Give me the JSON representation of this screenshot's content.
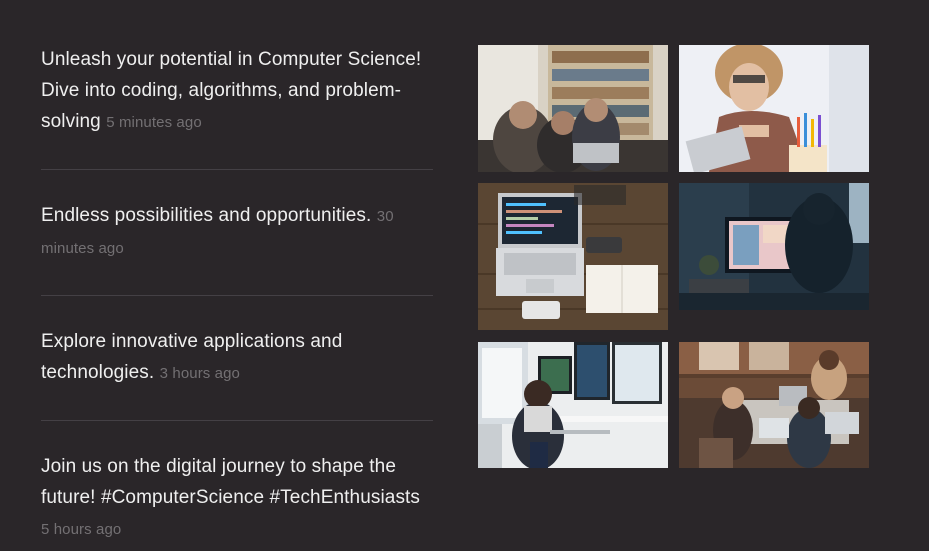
{
  "feed": {
    "posts": [
      {
        "text": "Unleash your potential in Computer Science! Dive into coding, algorithms, and problem-solving",
        "time": "5 minutes ago"
      },
      {
        "text": "Endless possibilities and opportunities.",
        "time": "30 minutes ago"
      },
      {
        "text": "Explore innovative applications and technologies.",
        "time": "3 hours ago"
      },
      {
        "text": "Join us on the digital journey to shape the future! #ComputerScience #TechEnthusiasts",
        "time": "5 hours ago"
      }
    ]
  },
  "gallery": {
    "photos": [
      {
        "alt": "group-collaborating-at-laptop"
      },
      {
        "alt": "student-thinking-with-pencils"
      },
      {
        "alt": "macbook-code-on-wooden-desk"
      },
      {
        "alt": "person-at-monitor-in-dark-room"
      },
      {
        "alt": "woman-coding-at-multi-monitor-desk"
      },
      {
        "alt": "team-working-on-laptops"
      }
    ]
  },
  "colors": {
    "background": "#2a2629",
    "text": "#efefef",
    "muted": "#737073",
    "divider": "#444045"
  }
}
